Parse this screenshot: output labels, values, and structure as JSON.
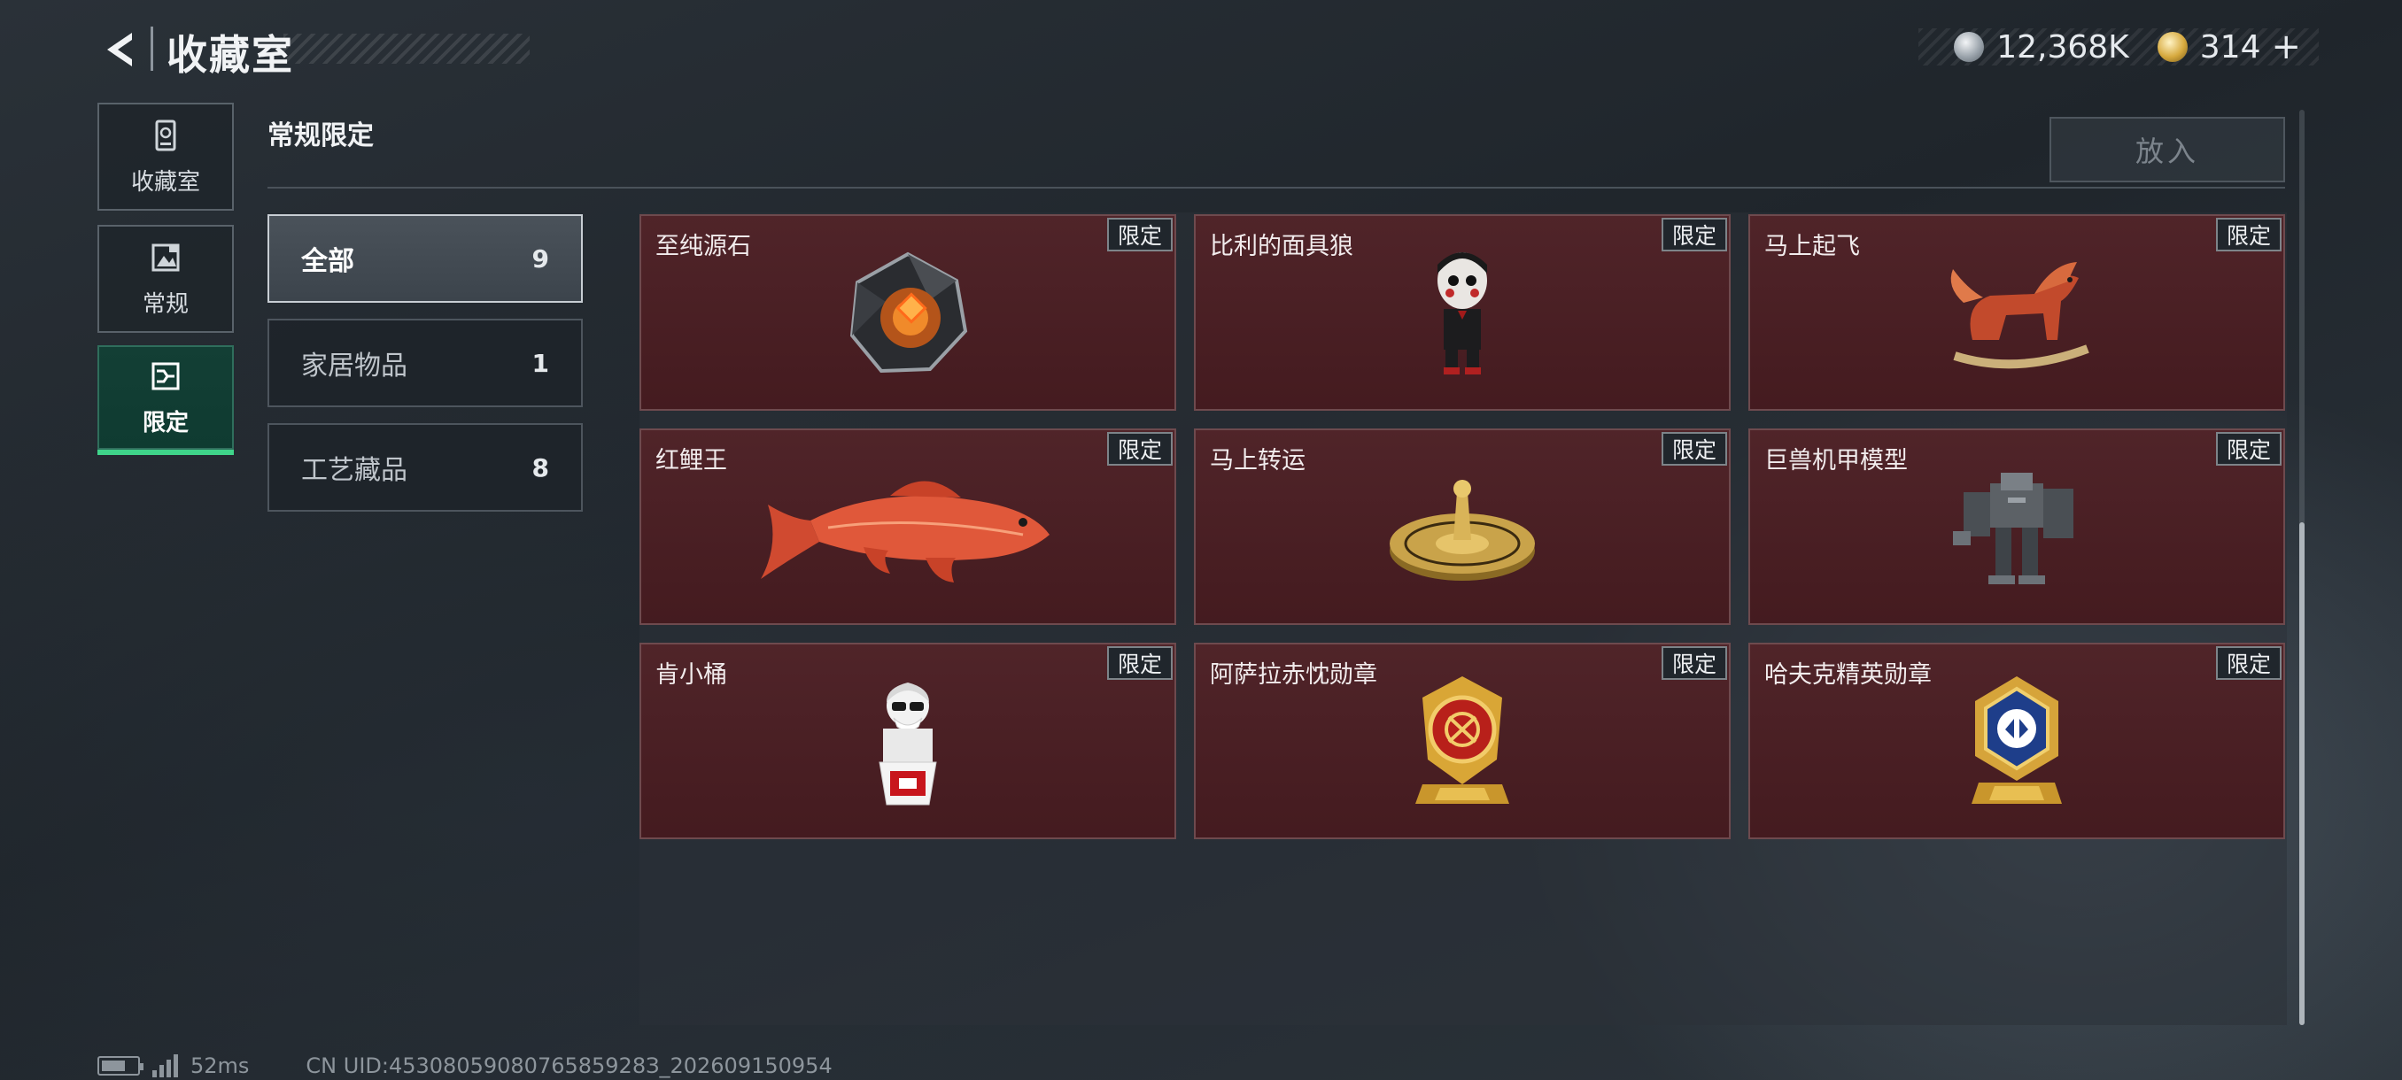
{
  "header": {
    "title": "收藏室",
    "currency": [
      {
        "icon": "silver-coin-icon",
        "value": "12,368K"
      },
      {
        "icon": "gold-coin-icon",
        "value": "314"
      }
    ],
    "plus_label": "+"
  },
  "sidebar": {
    "items": [
      {
        "label": "收藏室",
        "icon": "collection-room-icon",
        "active": false
      },
      {
        "label": "常规",
        "icon": "regular-icon",
        "active": false
      },
      {
        "label": "限定",
        "icon": "limited-icon",
        "active": true
      }
    ]
  },
  "section": {
    "title": "常规限定",
    "place_button": "放入"
  },
  "categories": [
    {
      "name": "全部",
      "count": "9",
      "active": true
    },
    {
      "name": "家居物品",
      "count": "1",
      "active": false
    },
    {
      "name": "工艺藏品",
      "count": "8",
      "active": false
    }
  ],
  "items": [
    {
      "name": "至纯源石",
      "tag": "限定",
      "icon": "gem-stone-icon"
    },
    {
      "name": "比利的面具狼",
      "tag": "限定",
      "icon": "puppet-figure-icon"
    },
    {
      "name": "马上起飞",
      "tag": "限定",
      "icon": "rocking-horse-icon"
    },
    {
      "name": "红鲤王",
      "tag": "限定",
      "icon": "red-carp-icon"
    },
    {
      "name": "马上转运",
      "tag": "限定",
      "icon": "golden-disc-icon"
    },
    {
      "name": "巨兽机甲模型",
      "tag": "限定",
      "icon": "mech-model-icon"
    },
    {
      "name": "肯小桶",
      "tag": "限定",
      "icon": "bucket-figure-icon"
    },
    {
      "name": "阿萨拉赤忱勋章",
      "tag": "限定",
      "icon": "red-medal-icon"
    },
    {
      "name": "哈夫克精英勋章",
      "tag": "限定",
      "icon": "blue-medal-icon"
    }
  ],
  "status_bar": {
    "ping": "52ms",
    "uid": "CN UID:4530805908076585928З_202609150954"
  },
  "colors": {
    "accent": "#3fd48a",
    "card_bg": "#4a1d22",
    "active_tab": "#0f3b31"
  }
}
